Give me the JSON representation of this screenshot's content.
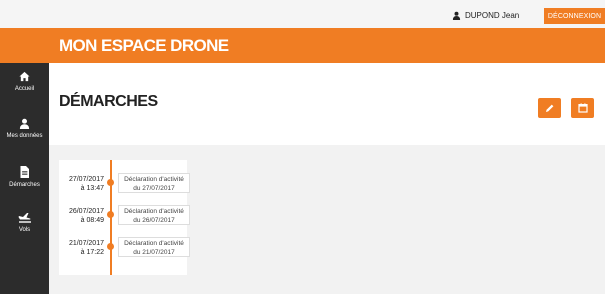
{
  "header": {
    "user_name": "DUPOND Jean",
    "logout_label": "DÉCONNEXION"
  },
  "brand": {
    "title": "MON ESPACE DRONE"
  },
  "sidebar": {
    "items": [
      {
        "label": "Accueil",
        "icon": "home-icon"
      },
      {
        "label": "Mes données",
        "icon": "user-icon"
      },
      {
        "label": "Démarches",
        "icon": "document-icon"
      },
      {
        "label": "Vols",
        "icon": "plane-icon"
      }
    ]
  },
  "main": {
    "title": "DÉMARCHES",
    "actions": [
      {
        "icon": "pencil-icon"
      },
      {
        "icon": "calendar-icon"
      }
    ],
    "timeline": [
      {
        "date": "27/07/2017",
        "time": "à 13:47",
        "title": "Déclaration d'activité",
        "subtitle": "du 27/07/2017"
      },
      {
        "date": "26/07/2017",
        "time": "à 08:49",
        "title": "Déclaration d'activité",
        "subtitle": "du 26/07/2017"
      },
      {
        "date": "21/07/2017",
        "time": "à 17:22",
        "title": "Déclaration d'activité",
        "subtitle": "du 21/07/2017"
      }
    ]
  },
  "colors": {
    "accent": "#f07d23",
    "sidebar": "#2c2c2c"
  }
}
